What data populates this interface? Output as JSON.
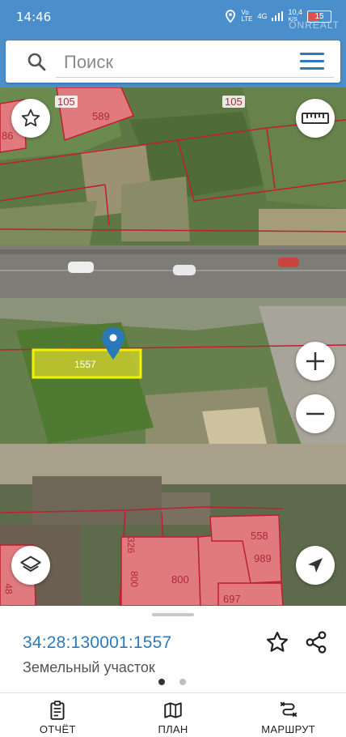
{
  "status_bar": {
    "time": "14:46",
    "network": "4G",
    "speed": "10,4",
    "speed_unit": "K/S",
    "battery": "15",
    "watermark": "ONREALT"
  },
  "search": {
    "placeholder": "Поиск"
  },
  "map": {
    "plot_labels": {
      "top_left": "105",
      "top_center": "105",
      "top_parcel": "589",
      "edge_left": "86",
      "selected": "1557",
      "bottom_326": "326",
      "bottom_800a": "800",
      "bottom_800b": "800",
      "bottom_558": "558",
      "bottom_989": "989",
      "bottom_697": "697",
      "bottom_edge": "48"
    },
    "colors": {
      "parcel_fill": "#e07a7f",
      "parcel_border": "#c01f2f",
      "selected_fill": "#c9cc2f",
      "selected_border": "#f2f200",
      "marker": "#2a78b8"
    }
  },
  "parcel": {
    "cadastral_number": "34:28:130001:1557",
    "type": "Земельный участок"
  },
  "bottom_nav": {
    "items": [
      {
        "label": "ОТЧЁТ",
        "icon": "clipboard-icon"
      },
      {
        "label": "ПЛАН",
        "icon": "map-icon"
      },
      {
        "label": "МАРШРУТ",
        "icon": "route-icon"
      }
    ]
  }
}
